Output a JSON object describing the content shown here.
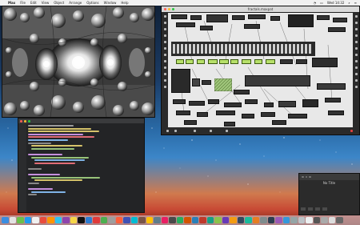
{
  "menubar": {
    "apple": "",
    "items": [
      "Max",
      "File",
      "Edit",
      "View",
      "Object",
      "Arrange",
      "Options",
      "Window",
      "Help"
    ],
    "status": [
      "Wed 14:32"
    ]
  },
  "fractal_window": {
    "title": ""
  },
  "editor": {
    "title": ""
  },
  "patcher": {
    "title": "fractals.maxpat",
    "accent": "#b7e06a"
  },
  "small_window": {
    "title": "",
    "label": "No Title"
  },
  "dock": {
    "colors": [
      "#3b8de0",
      "#e3e3e3",
      "#6ac04a",
      "#1e9bf0",
      "#f0f0f0",
      "#e94c3d",
      "#ff9500",
      "#2ec4f0",
      "#8e44ad",
      "#f5d547",
      "#111111",
      "#2d7dd2",
      "#e03a3a",
      "#4caf50",
      "#9e9e9e",
      "#ff5e3a",
      "#3f51b5",
      "#00bcd4",
      "#795548",
      "#ffc107",
      "#607d8b",
      "#e91e63",
      "#4a4a4a",
      "#27ae60",
      "#d35400",
      "#2980b9",
      "#c0392b",
      "#16a085",
      "#8bc34a",
      "#673ab7",
      "#f39c12",
      "#34495e",
      "#1abc9c",
      "#e67e22",
      "#7f8c8d",
      "#2c3e50",
      "#9b59b6",
      "#3498db",
      "#95a5a6",
      "#bdc3c7",
      "#ecf0f1",
      "#555555",
      "#aaaaaa",
      "#dddddd",
      "#666666"
    ]
  }
}
